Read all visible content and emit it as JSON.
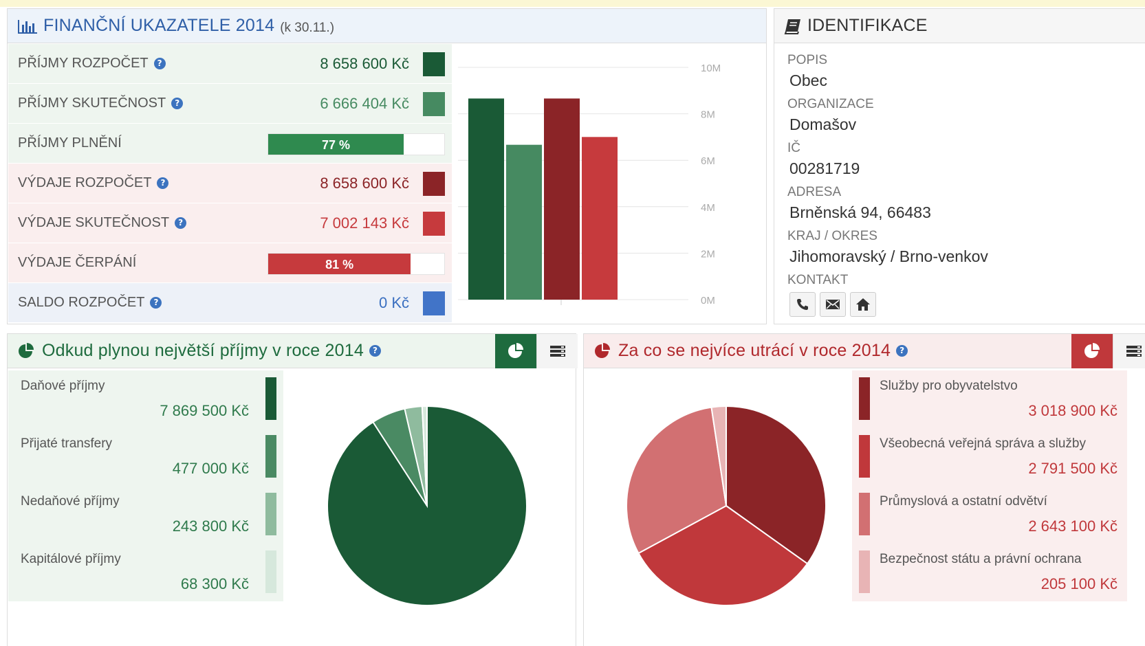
{
  "financial": {
    "title": "FINANČNÍ UKAZATELE 2014",
    "subtitle": "(k 30.11.)",
    "rows": [
      {
        "label": "PŘÍJMY ROZPOČET",
        "value": "8 658 600 Kč",
        "color": "#1a5a36",
        "help": true
      },
      {
        "label": "PŘÍJMY SKUTEČNOST",
        "value": "6 666 404 Kč",
        "color": "#468a61",
        "help": true
      },
      {
        "label": "PŘÍJMY PLNĚNÍ",
        "progress": 0.77,
        "progress_text": "77 %",
        "color": "#2f8a4f"
      },
      {
        "label": "VÝDAJE ROZPOČET",
        "value": "8 658 600 Kč",
        "color": "#8b2427",
        "help": true
      },
      {
        "label": "VÝDAJE SKUTEČNOST",
        "value": "7 002 143 Kč",
        "color": "#c63a3d",
        "help": true
      },
      {
        "label": "VÝDAJE ČERPÁNÍ",
        "progress": 0.81,
        "progress_text": "81 %",
        "color": "#c63a3d"
      },
      {
        "label": "SALDO ROZPOČET",
        "value": "0 Kč",
        "color": "#4174c8",
        "help": true
      }
    ]
  },
  "identification": {
    "title": "IDENTIFIKACE",
    "fields": [
      {
        "key": "POPIS",
        "value": "Obec"
      },
      {
        "key": "ORGANIZACE",
        "value": "Domašov"
      },
      {
        "key": "IČ",
        "value": "00281719"
      },
      {
        "key": "ADRESA",
        "value": "Brněnská 94, 66483"
      },
      {
        "key": "KRAJ / OKRES",
        "value": "Jihomoravský / Brno-venkov"
      }
    ],
    "contact_label": "KONTAKT",
    "contact_icons": [
      "phone-icon",
      "envelope-icon",
      "home-icon"
    ]
  },
  "income": {
    "title": "Odkud plynou největší příjmy v roce 2014",
    "accent": "#1e6b3e"
  },
  "expense": {
    "title": "Za co se nejvíce utrácí v roce 2014",
    "accent": "#b0282c"
  },
  "chart_data": [
    {
      "type": "bar",
      "categories": [
        "Příjmy rozpočet",
        "Příjmy skutečnost",
        "Výdaje rozpočet",
        "Výdaje skutečnost"
      ],
      "values": [
        8658600,
        6666404,
        8658600,
        7002143
      ],
      "colors": [
        "#1a5a36",
        "#468a61",
        "#8b2427",
        "#c63a3d"
      ],
      "ylim": [
        0,
        10000000
      ],
      "yticks": [
        0,
        2000000,
        4000000,
        6000000,
        8000000,
        10000000
      ],
      "ytick_labels": [
        "0M",
        "2M",
        "4M",
        "6M",
        "8M",
        "10M"
      ],
      "grid": true
    },
    {
      "type": "pie",
      "categories": [
        "Daňové příjmy",
        "Přijaté transfery",
        "Nedaňové příjmy",
        "Kapitálové příjmy"
      ],
      "values": [
        7869500,
        477000,
        243800,
        68300
      ],
      "value_labels": [
        "7 869 500 Kč",
        "477 000 Kč",
        "243 800 Kč",
        "68 300 Kč"
      ],
      "colors": [
        "#1a5a36",
        "#4a8a63",
        "#8fbb9e",
        "#d6e8dc"
      ]
    },
    {
      "type": "pie",
      "categories": [
        "Služby pro obyvatelstvo",
        "Všeobecná veřejná správa a služby",
        "Průmyslová a ostatní odvětví",
        "Bezpečnost státu a právní ochrana"
      ],
      "values": [
        3018900,
        2791500,
        2643100,
        205100
      ],
      "value_labels": [
        "3 018 900 Kč",
        "2 791 500 Kč",
        "2 643 100 Kč",
        "205 100 Kč"
      ],
      "colors": [
        "#8b2427",
        "#c0383b",
        "#d27072",
        "#e8b4b5"
      ]
    }
  ]
}
